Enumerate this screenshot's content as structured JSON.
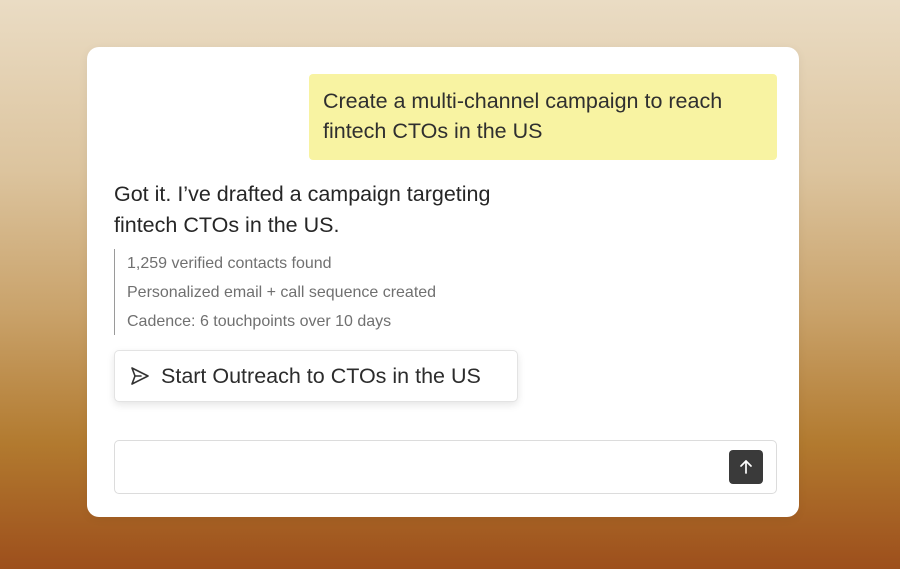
{
  "chat": {
    "user_message": "Create a multi-channel campaign to reach fintech CTOs in the US",
    "assistant_reply": {
      "line1": "Got it. I’ve drafted a campaign targeting",
      "line2": "fintech CTOs in the US."
    },
    "details": [
      "1,259 verified contacts found",
      "Personalized email + call sequence created",
      "Cadence: 6 touchpoints over 10 days"
    ],
    "action": {
      "label": "Start Outreach to CTOs in the US",
      "icon": "send-icon"
    }
  },
  "composer": {
    "value": "",
    "placeholder": "",
    "submit_icon": "arrow-up-icon"
  },
  "colors": {
    "user_bubble": "#f8f3a2",
    "submit_button": "#3a3a3a"
  }
}
